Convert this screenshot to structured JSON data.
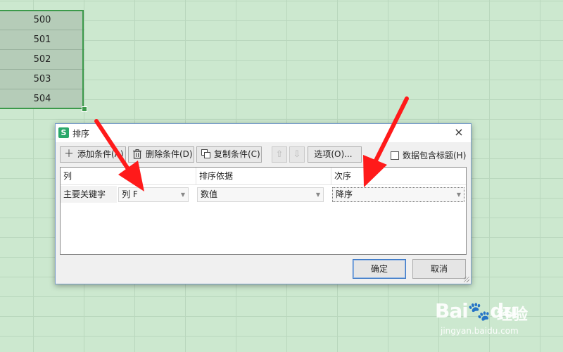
{
  "sheet": {
    "cells": [
      "500",
      "501",
      "502",
      "503",
      "504"
    ]
  },
  "dialog": {
    "title": "排序",
    "app_icon": "S",
    "close_glyph": "×",
    "toolbar": {
      "add": "添加条件(A)",
      "delete": "删除条件(D)",
      "copy": "复制条件(C)",
      "options": "选项(O)...",
      "has_header": "数据包含标题(H)",
      "up_glyph": "⇧",
      "down_glyph": "⇩"
    },
    "grid": {
      "headers": {
        "column": "列",
        "sort_on": "排序依据",
        "order": "次序"
      },
      "row": {
        "label": "主要关键字",
        "column_value": "列 F",
        "sort_on_value": "数值",
        "order_value": "降序"
      }
    },
    "buttons": {
      "ok": "确定",
      "cancel": "取消"
    }
  },
  "watermark": {
    "logo": "Bai",
    "logo_tail": "du",
    "zh": "经验",
    "url": "jingyan.baidu.com"
  },
  "colors": {
    "sheet_bg": "#cce8cf",
    "selection_border": "#3c9a4b",
    "annotation_arrow": "#ff1a1a",
    "ok_border": "#3b78c6"
  }
}
